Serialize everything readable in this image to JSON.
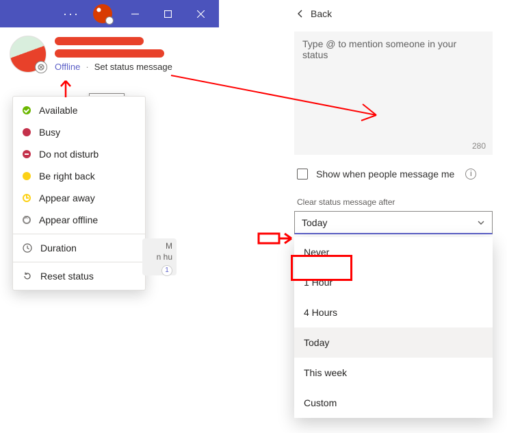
{
  "titlebar": {
    "more": "···"
  },
  "profile": {
    "status_text": "Offline",
    "status_sep": "·",
    "set_status_link": "Set status message",
    "tooltip": "Offline"
  },
  "status_menu": {
    "items": [
      {
        "label": "Available"
      },
      {
        "label": "Busy"
      },
      {
        "label": "Do not disturb"
      },
      {
        "label": "Be right back"
      },
      {
        "label": "Appear away"
      },
      {
        "label": "Appear offline"
      }
    ],
    "duration": "Duration",
    "reset": "Reset status"
  },
  "chat_preview": {
    "line1": "M",
    "line2": "n hu",
    "badge": "1"
  },
  "right": {
    "back": "Back",
    "placeholder": "Type @ to mention someone in your status",
    "char_count": "280",
    "show_when": "Show when people message me",
    "clear_label": "Clear status message after",
    "selected": "Today",
    "options": [
      "Never",
      "1 Hour",
      "4 Hours",
      "Today",
      "This week",
      "Custom"
    ]
  }
}
